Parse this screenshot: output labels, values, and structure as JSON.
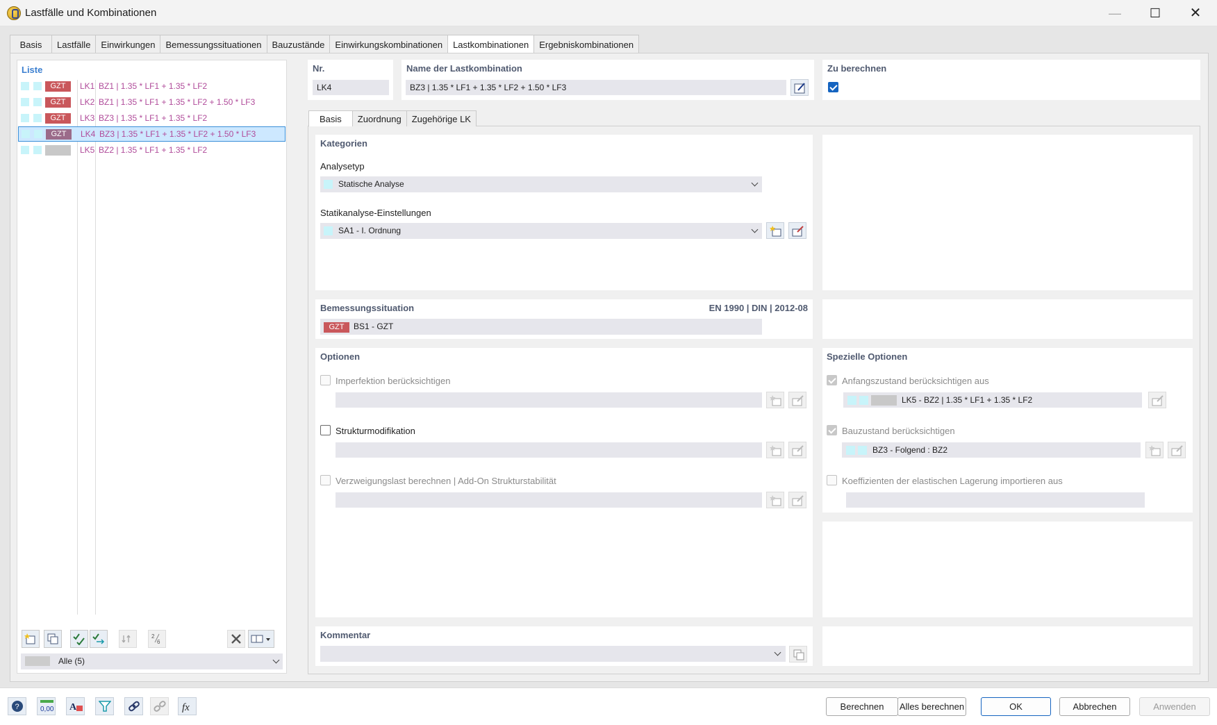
{
  "window": {
    "title": "Lastfälle und Kombinationen"
  },
  "tabs": [
    "Basis",
    "Lastfälle",
    "Einwirkungen",
    "Bemessungssituationen",
    "Bauzustände",
    "Einwirkungskombinationen",
    "Lastkombinationen",
    "Ergebniskombinationen"
  ],
  "active_tab": "Lastkombinationen",
  "list": {
    "header": "Liste",
    "items": [
      {
        "badge": "GZT",
        "id": "LK1",
        "desc": "BZ1 | 1.35 * LF1 + 1.35 * LF2"
      },
      {
        "badge": "GZT",
        "id": "LK2",
        "desc": "BZ1 | 1.35 * LF1 + 1.35 * LF2 + 1.50 * LF3"
      },
      {
        "badge": "GZT",
        "id": "LK3",
        "desc": "BZ3 | 1.35 * LF1 + 1.35 * LF2"
      },
      {
        "badge": "GZT",
        "id": "LK4",
        "desc": "BZ3 | 1.35 * LF1 + 1.35 * LF2 + 1.50 * LF3"
      },
      {
        "badge": "",
        "id": "LK5",
        "desc": "BZ2 | 1.35 * LF1 + 1.35 * LF2"
      }
    ],
    "selected_index": 3,
    "filter": "Alle (5)"
  },
  "header": {
    "nr_label": "Nr.",
    "nr_value": "LK4",
    "name_label": "Name der Lastkombination",
    "name_value": "BZ3 | 1.35 * LF1 + 1.35 * LF2 + 1.50 * LF3",
    "calc_label": "Zu berechnen",
    "calc_checked": true
  },
  "subtabs": [
    "Basis",
    "Zuordnung",
    "Zugehörige LK"
  ],
  "kategorien": {
    "title": "Kategorien",
    "analysetyp_label": "Analysetyp",
    "analysetyp_value": "Statische Analyse",
    "statik_label": "Statikanalyse-Einstellungen",
    "statik_value": "SA1 - I. Ordnung"
  },
  "bemessung": {
    "title": "Bemessungssituation",
    "norm": "EN 1990 | DIN | 2012-08",
    "badge": "GZT",
    "value": "BS1 - GZT"
  },
  "optionen": {
    "title": "Optionen",
    "imperfektion": "Imperfektion berücksichtigen",
    "strukturmod": "Strukturmodifikation",
    "verzweigung": "Verzweigungslast berechnen | Add-On Strukturstabilität"
  },
  "spezielle": {
    "title": "Spezielle Optionen",
    "anfang_label": "Anfangszustand berücksichtigen aus",
    "anfang_value": "LK5 - BZ2 | 1.35 * LF1 + 1.35 * LF2",
    "bauzustand_label": "Bauzustand berücksichtigen",
    "bauzustand_value": "BZ3 - Folgend : BZ2",
    "koeff_label": "Koeffizienten der elastischen Lagerung importieren aus"
  },
  "kommentar": {
    "title": "Kommentar",
    "value": ""
  },
  "buttons": {
    "berechnen": "Berechnen",
    "alles": "Alles berechnen",
    "ok": "OK",
    "abbrechen": "Abbrechen",
    "anwenden": "Anwenden"
  },
  "bottom_icons": [
    "help-icon",
    "units-icon",
    "font-icon",
    "filter-icon",
    "link-icon",
    "unlink-icon",
    "formula-icon"
  ],
  "bottom_units_text": "0,00",
  "colors": {
    "gzt": "#c9575b",
    "accent": "#1564c0",
    "item_text": "#b04b9a",
    "swatch": "#c8f4fa"
  }
}
